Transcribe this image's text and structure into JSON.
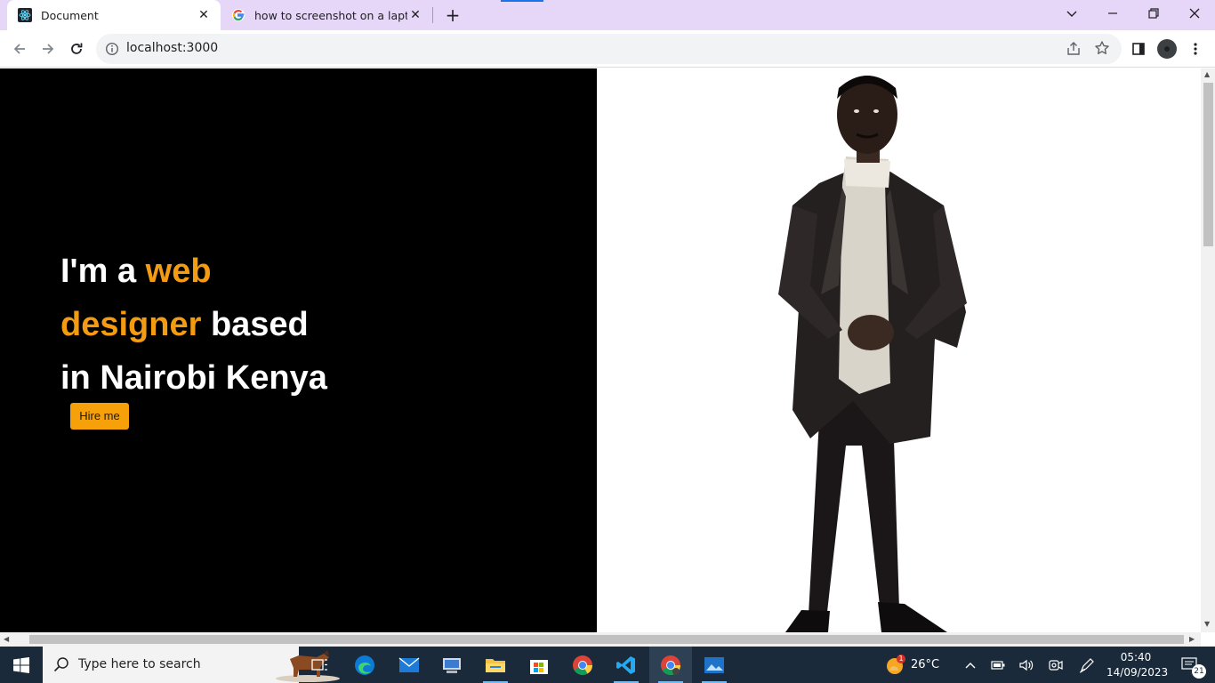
{
  "browser": {
    "tabs": [
      {
        "title": "Document",
        "active": true
      },
      {
        "title": "how to screenshot on a laptop -",
        "active": false
      }
    ],
    "new_tab_label": "+",
    "url": "localhost:3000"
  },
  "page": {
    "headline": {
      "part1": "I'm a ",
      "accent1": "web",
      "accent2": "designer",
      "part2": " based",
      "part3": "in Nairobi Kenya"
    },
    "hire_button": "Hire me",
    "accent_color": "#f39c12"
  },
  "taskbar": {
    "search_placeholder": "Type here to search",
    "weather": "26°C",
    "weather_badge": "1",
    "time": "05:40",
    "date": "14/09/2023",
    "notification_count": "21"
  }
}
